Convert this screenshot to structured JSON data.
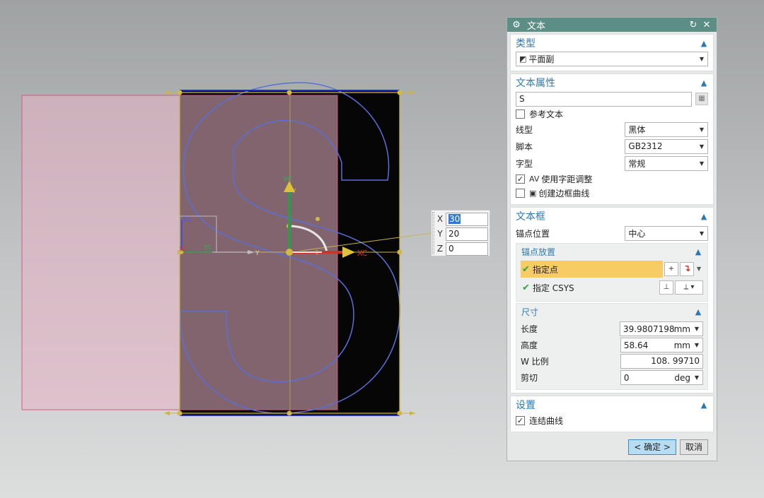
{
  "coord_input": {
    "x_label": "X",
    "x_value": "30",
    "y_label": "Y",
    "y_value": "20",
    "z_label": "Z",
    "z_value": "0"
  },
  "viewport_labels": {
    "yc": "YC",
    "xc": "XC",
    "y": "Y",
    "zc": "ZC",
    "xc_small": "XC",
    "yc_small": "YC",
    "y_small": "Y"
  },
  "dialog": {
    "title": "文本",
    "type_section": {
      "title": "类型",
      "value": "平面副"
    },
    "props_section": {
      "title": "文本属性",
      "text_value": "S",
      "ref_text_label": "参考文本",
      "line_type": {
        "label": "线型",
        "value": "黑体"
      },
      "script": {
        "label": "脚本",
        "value": "GB2312"
      },
      "font_style": {
        "label": "字型",
        "value": "常规"
      },
      "kerning_label": "使用字距调整",
      "kerning_checked": true,
      "border_label": "创建边框曲线",
      "border_checked": false
    },
    "frame_section": {
      "title": "文本框",
      "anchor_pos": {
        "label": "锚点位置",
        "value": "中心"
      },
      "anchor_place": {
        "title": "锚点放置",
        "point_label": "指定点",
        "csys_label": "指定 CSYS"
      },
      "dimensions": {
        "title": "尺寸",
        "length": {
          "label": "长度",
          "value": "39.9807198",
          "unit": "mm"
        },
        "height": {
          "label": "高度",
          "value": "58.64",
          "unit": "mm"
        },
        "w_scale": {
          "label": "W 比例",
          "value": "108. 99710"
        },
        "shear": {
          "label": "剪切",
          "value": "0",
          "unit": "deg"
        }
      }
    },
    "settings_section": {
      "title": "设置",
      "join_label": "连结曲线",
      "join_checked": true
    },
    "ok_label": "< 确定 >",
    "cancel_label": "取消"
  },
  "colors": {
    "titlebar": "#5c8e85",
    "section_title": "#2f78ad",
    "active_row": "#f7cc64",
    "letter_outline": "#5a6fd8",
    "pink_preview": "#e8b2c4",
    "frame_gold": "#c9b34a"
  }
}
